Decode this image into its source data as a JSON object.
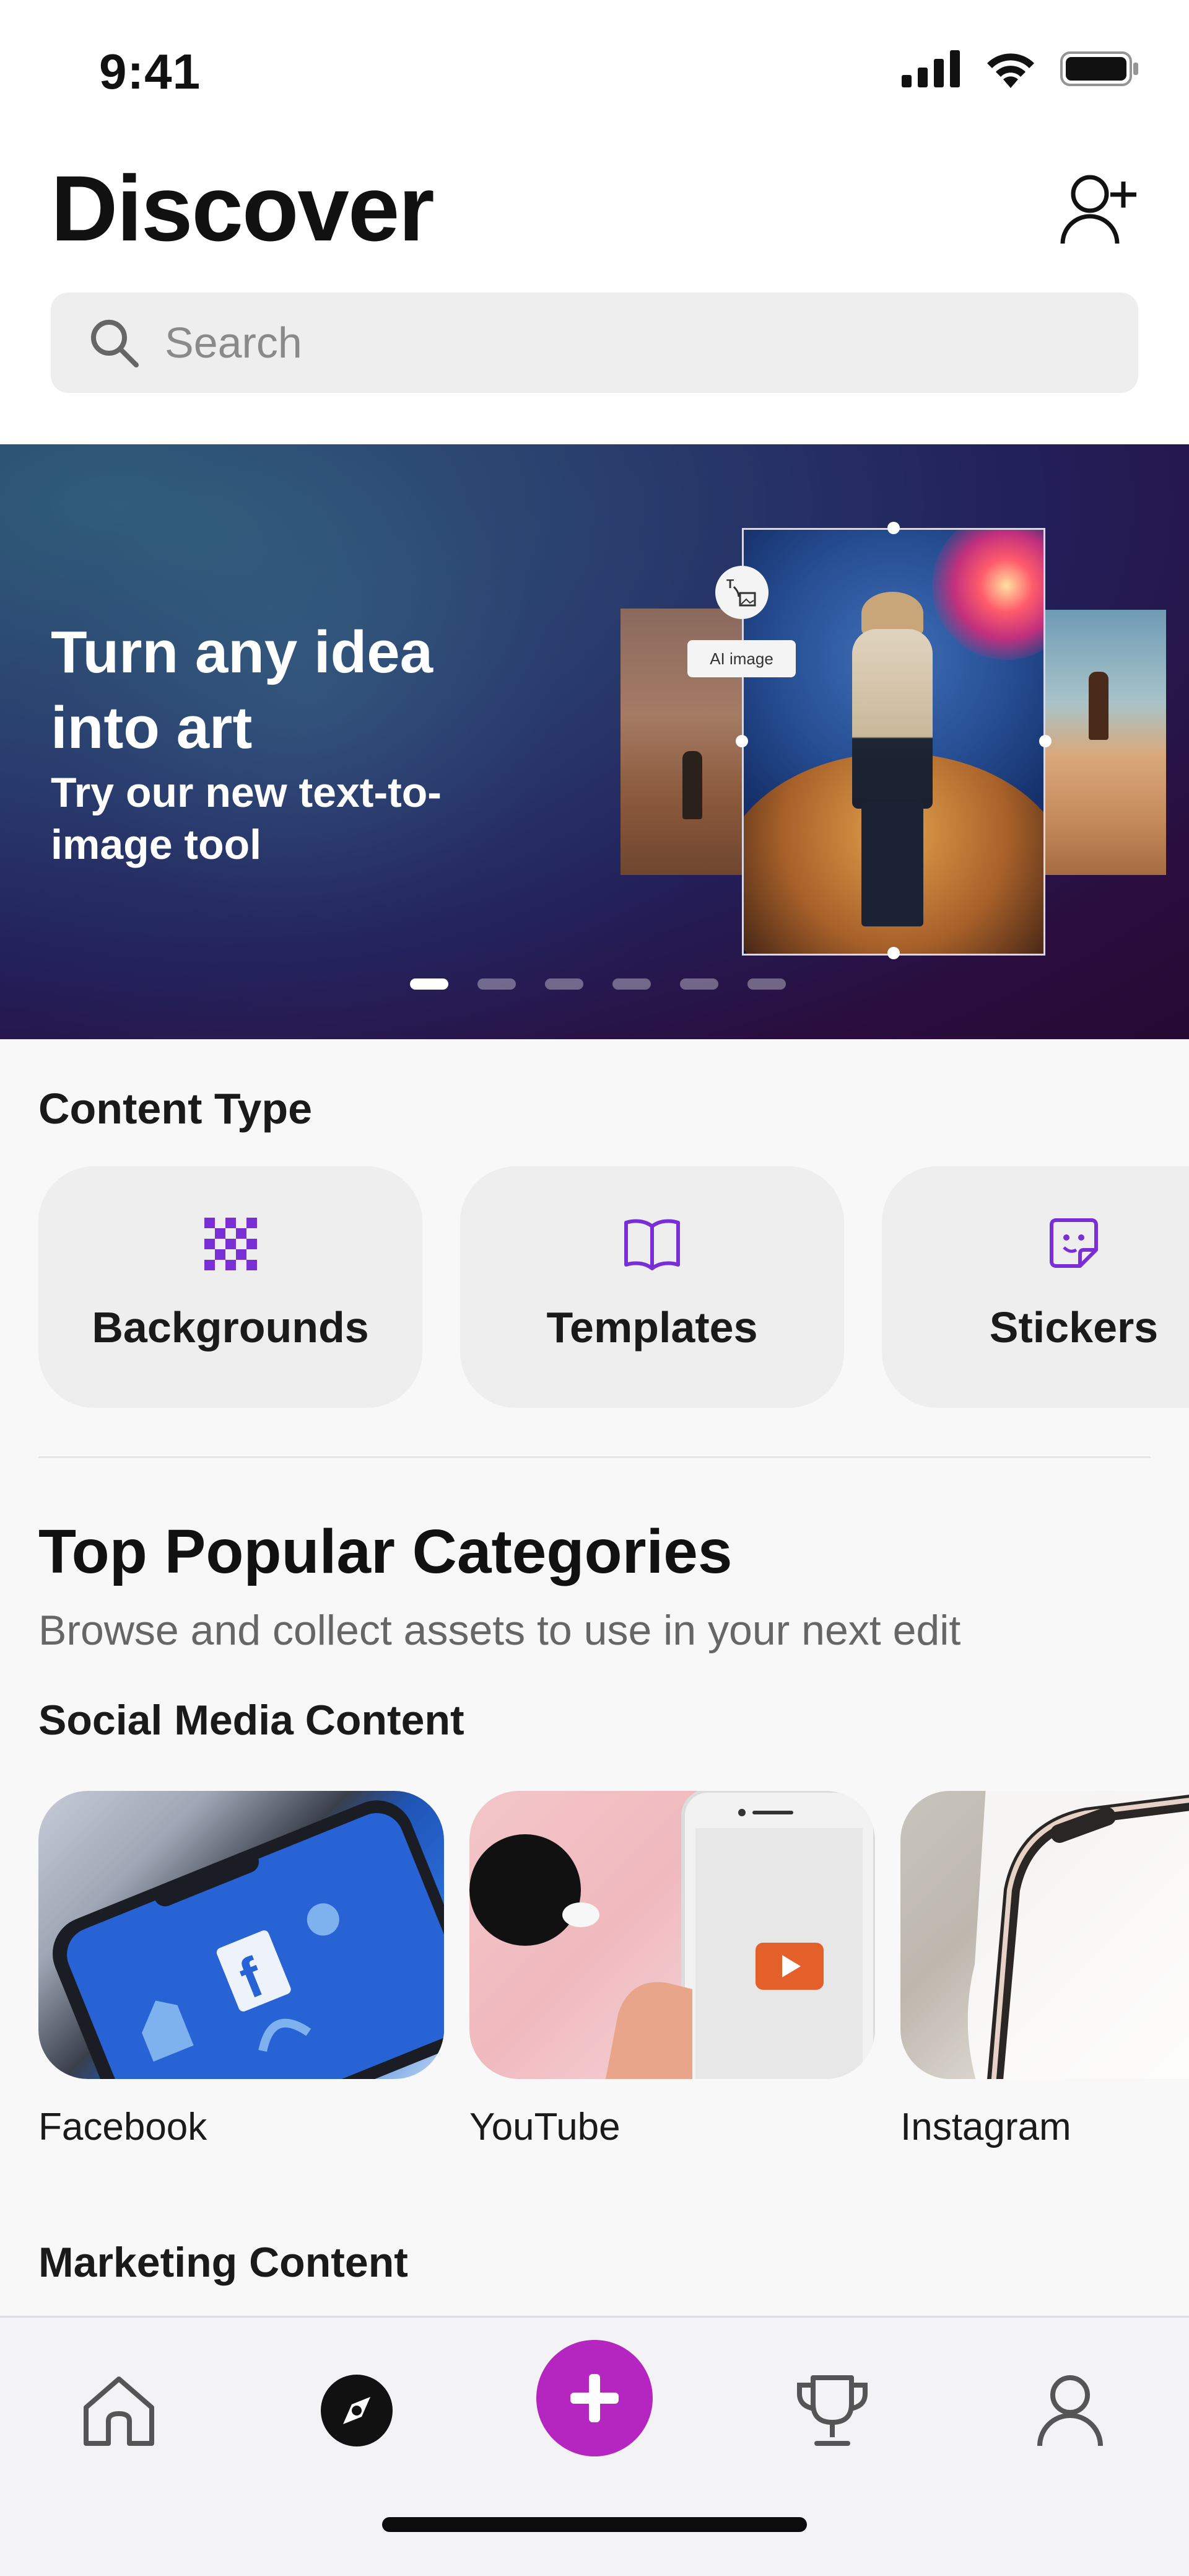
{
  "status_bar": {
    "time": "9:41"
  },
  "header": {
    "title": "Discover"
  },
  "search": {
    "placeholder": "Search"
  },
  "hero": {
    "title": "Turn any idea into art",
    "subtitle": "Try our new text-to-image tool",
    "chip_label": "AI image",
    "slide_count": 6,
    "active_slide": 1
  },
  "content_type": {
    "label": "Content Type",
    "items": [
      {
        "label": "Backgrounds",
        "icon": "checker-grid-icon"
      },
      {
        "label": "Templates",
        "icon": "open-book-icon"
      },
      {
        "label": "Stickers",
        "icon": "sticker-icon"
      }
    ]
  },
  "popular": {
    "title": "Top Popular Categories",
    "subtitle": "Browse and collect assets to use in your next edit",
    "social_label": "Social Media Content",
    "social_items": [
      {
        "label": "Facebook"
      },
      {
        "label": "YouTube"
      },
      {
        "label": "Instagram"
      }
    ],
    "marketing_label": "Marketing Content"
  },
  "nav": {
    "items": [
      "home-icon",
      "compass-icon",
      "plus-icon",
      "trophy-icon",
      "profile-icon"
    ],
    "active": "compass-icon"
  },
  "colors": {
    "accent": "#b526c1",
    "icon_purple": "#7a2fd6"
  }
}
